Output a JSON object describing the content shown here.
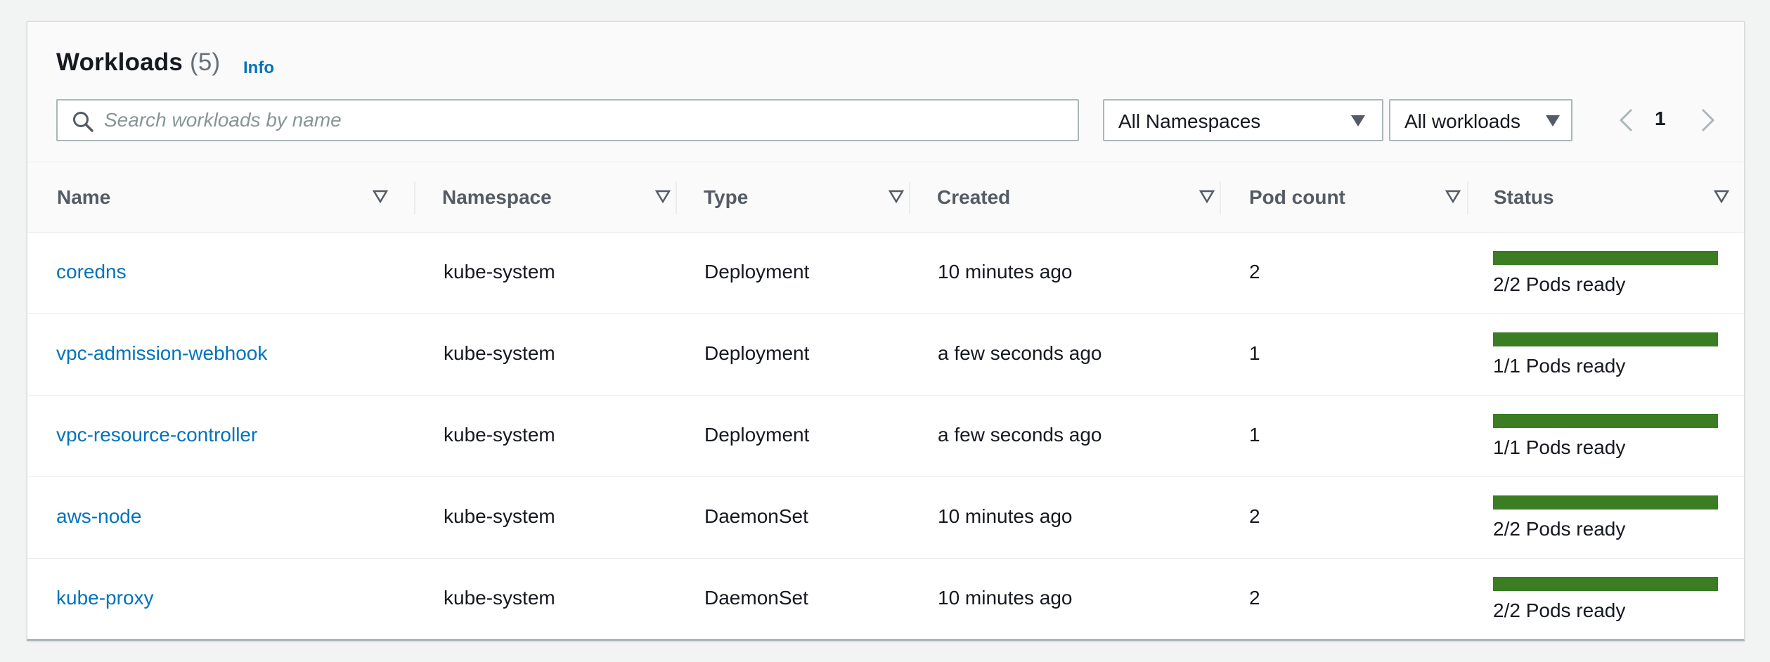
{
  "header": {
    "title": "Workloads",
    "count": "(5)",
    "info_label": "Info"
  },
  "search": {
    "placeholder": "Search workloads by name",
    "value": "",
    "icon": "search-icon"
  },
  "filters": {
    "namespace_selected": "All Namespaces",
    "workload_selected": "All workloads"
  },
  "pagination": {
    "current_page": "1"
  },
  "columns": [
    "Name",
    "Namespace",
    "Type",
    "Created",
    "Pod count",
    "Status"
  ],
  "rows": [
    {
      "name": "coredns",
      "namespace": "kube-system",
      "type": "Deployment",
      "created": "10 minutes ago",
      "pod_count": "2",
      "status": "2/2 Pods ready",
      "ready_fraction": 1.0
    },
    {
      "name": "vpc-admission-webhook",
      "namespace": "kube-system",
      "type": "Deployment",
      "created": "a few seconds ago",
      "pod_count": "1",
      "status": "1/1 Pods ready",
      "ready_fraction": 1.0
    },
    {
      "name": "vpc-resource-controller",
      "namespace": "kube-system",
      "type": "Deployment",
      "created": "a few seconds ago",
      "pod_count": "1",
      "status": "1/1 Pods ready",
      "ready_fraction": 1.0
    },
    {
      "name": "aws-node",
      "namespace": "kube-system",
      "type": "DaemonSet",
      "created": "10 minutes ago",
      "pod_count": "2",
      "status": "2/2 Pods ready",
      "ready_fraction": 1.0
    },
    {
      "name": "kube-proxy",
      "namespace": "kube-system",
      "type": "DaemonSet",
      "created": "10 minutes ago",
      "pod_count": "2",
      "status": "2/2 Pods ready",
      "ready_fraction": 1.0
    }
  ],
  "colors": {
    "link": "#0073bb",
    "progress_fill": "#3b7d23",
    "header_text": "#545b64"
  }
}
